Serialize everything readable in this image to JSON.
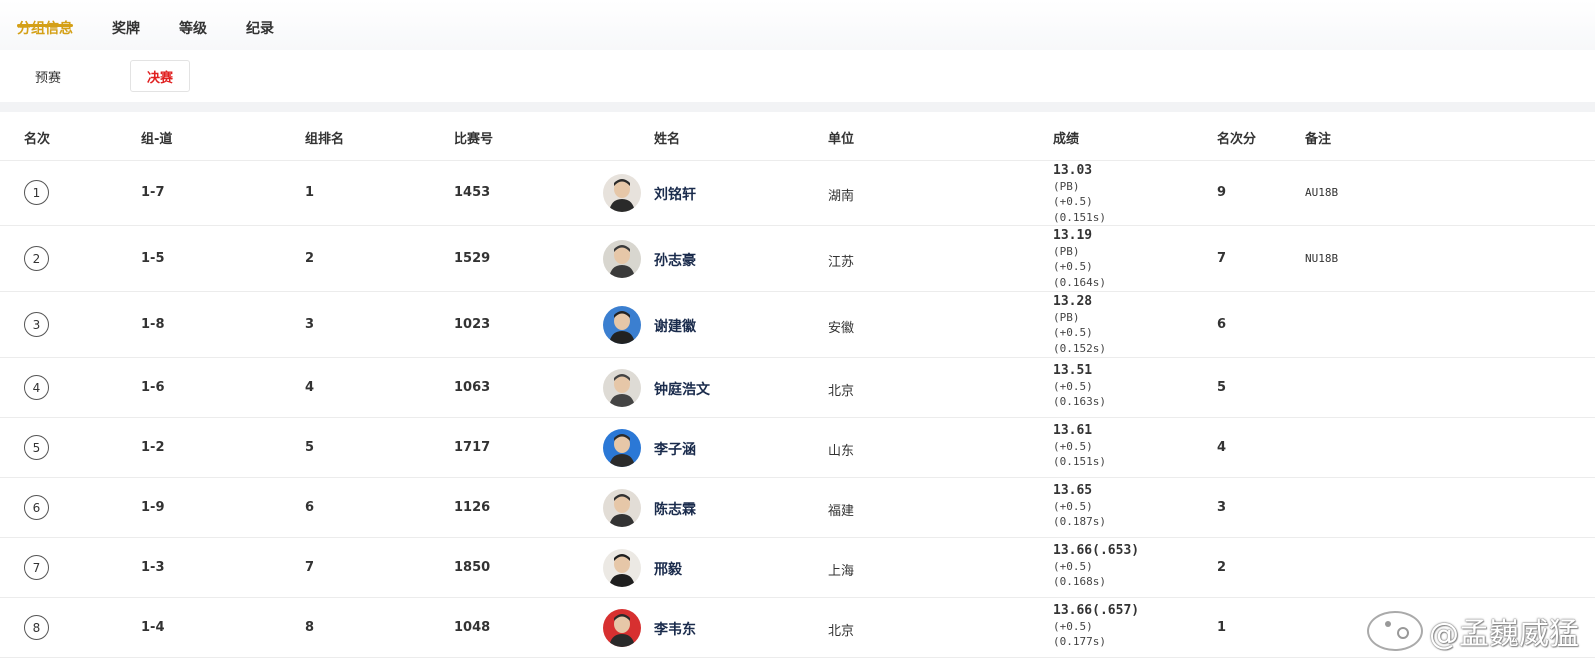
{
  "tabs": [
    {
      "label": "分组信息",
      "active": true
    },
    {
      "label": "奖牌",
      "active": false
    },
    {
      "label": "等级",
      "active": false
    },
    {
      "label": "纪录",
      "active": false
    }
  ],
  "subtabs": [
    {
      "label": "预赛",
      "active": false
    },
    {
      "label": "决赛",
      "active": true
    }
  ],
  "columns": {
    "rank": "名次",
    "lane": "组-道",
    "group_rank": "组排名",
    "bib": "比赛号",
    "name": "姓名",
    "unit": "单位",
    "result": "成绩",
    "points": "名次分",
    "note": "备注"
  },
  "rows": [
    {
      "rank": "1",
      "lane": "1-7",
      "group_rank": "1",
      "bib": "1453",
      "name": "刘铭轩",
      "unit": "湖南",
      "result": "13.03",
      "pb": "(PB)",
      "wind": "(+0.5)",
      "reaction": "(0.151s)",
      "points": "9",
      "note": "AU18B"
    },
    {
      "rank": "2",
      "lane": "1-5",
      "group_rank": "2",
      "bib": "1529",
      "name": "孙志豪",
      "unit": "江苏",
      "result": "13.19",
      "pb": "(PB)",
      "wind": "(+0.5)",
      "reaction": "(0.164s)",
      "points": "7",
      "note": "NU18B"
    },
    {
      "rank": "3",
      "lane": "1-8",
      "group_rank": "3",
      "bib": "1023",
      "name": "谢建徽",
      "unit": "安徽",
      "result": "13.28",
      "pb": "(PB)",
      "wind": "(+0.5)",
      "reaction": "(0.152s)",
      "points": "6",
      "note": ""
    },
    {
      "rank": "4",
      "lane": "1-6",
      "group_rank": "4",
      "bib": "1063",
      "name": "钟庭浩文",
      "unit": "北京",
      "result": "13.51",
      "pb": "",
      "wind": "(+0.5)",
      "reaction": "(0.163s)",
      "points": "5",
      "note": ""
    },
    {
      "rank": "5",
      "lane": "1-2",
      "group_rank": "5",
      "bib": "1717",
      "name": "李子涵",
      "unit": "山东",
      "result": "13.61",
      "pb": "",
      "wind": "(+0.5)",
      "reaction": "(0.151s)",
      "points": "4",
      "note": ""
    },
    {
      "rank": "6",
      "lane": "1-9",
      "group_rank": "6",
      "bib": "1126",
      "name": "陈志霖",
      "unit": "福建",
      "result": "13.65",
      "pb": "",
      "wind": "(+0.5)",
      "reaction": "(0.187s)",
      "points": "3",
      "note": ""
    },
    {
      "rank": "7",
      "lane": "1-3",
      "group_rank": "7",
      "bib": "1850",
      "name": "邢毅",
      "unit": "上海",
      "result": "13.66(.653)",
      "pb": "",
      "wind": "(+0.5)",
      "reaction": "(0.168s)",
      "points": "2",
      "note": ""
    },
    {
      "rank": "8",
      "lane": "1-4",
      "group_rank": "8",
      "bib": "1048",
      "name": "李韦东",
      "unit": "北京",
      "result": "13.66(.657)",
      "pb": "",
      "wind": "(+0.5)",
      "reaction": "(0.177s)",
      "points": "1",
      "note": ""
    }
  ],
  "watermark": "@孟巍威猛",
  "colors": {
    "accent": "#d4a017",
    "active_sub": "#e02020",
    "name": "#1a2b4c"
  }
}
